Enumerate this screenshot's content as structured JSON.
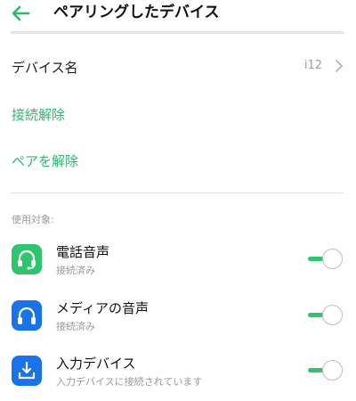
{
  "header": {
    "title": "ペアリングしたデバイス",
    "back_icon": "arrow-left-icon"
  },
  "device_name": {
    "label": "デバイス名",
    "value": "i12"
  },
  "actions": {
    "disconnect": "接続解除",
    "unpair": "ペアを解除"
  },
  "section_label": "使用対象:",
  "items": [
    {
      "title": "電話音声",
      "subtitle": "接続済み",
      "icon": "headset-icon",
      "icon_color": "#2ec56f",
      "enabled": true
    },
    {
      "title": "メディアの音声",
      "subtitle": "接続済み",
      "icon": "headphones-icon",
      "icon_color": "#1a73e8",
      "enabled": true
    },
    {
      "title": "入力デバイス",
      "subtitle": "入力デバイスに接続されています",
      "icon": "input-device-icon",
      "icon_color": "#1a73e8",
      "enabled": true
    }
  ],
  "colors": {
    "accent": "#2db770",
    "toggle_on": "#2ec56f"
  }
}
